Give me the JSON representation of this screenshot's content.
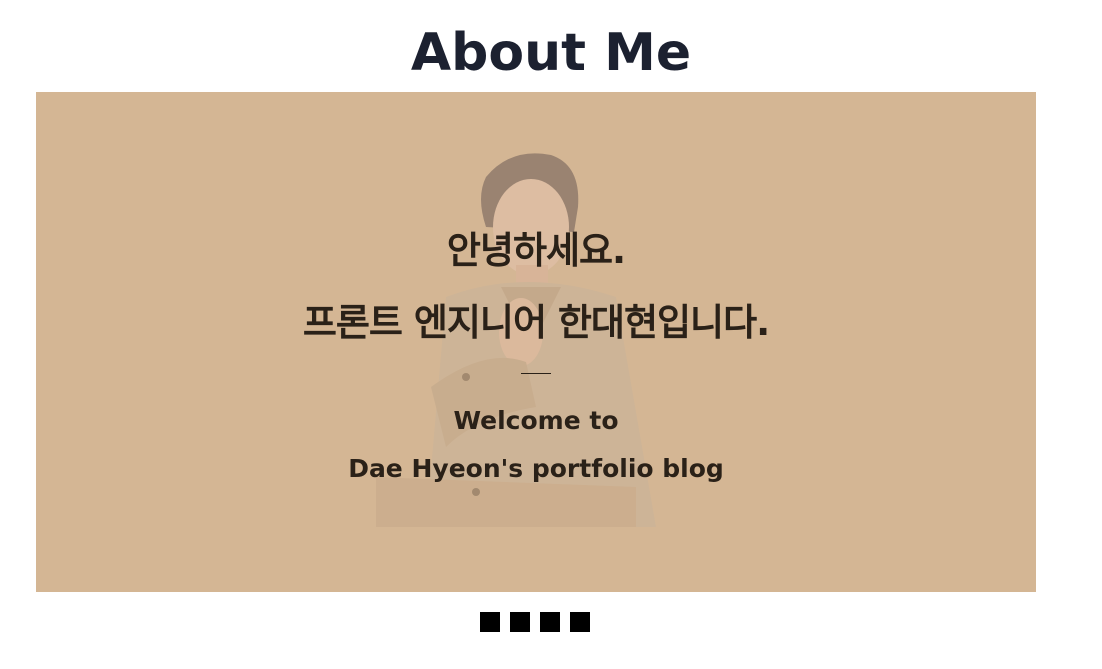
{
  "section": {
    "title": "About Me"
  },
  "slide": {
    "greeting_line1": "안녕하세요.",
    "greeting_line2": "프론트 엔지니어 한대현입니다.",
    "welcome_line1": "Welcome to",
    "welcome_line2": "Dae Hyeon's portfolio blog"
  },
  "colors": {
    "slide_background": "#d4b694",
    "title_text": "#1c2130",
    "slide_text": "#2a2118",
    "pager_dot": "#000000"
  },
  "pager": {
    "count": 4
  }
}
